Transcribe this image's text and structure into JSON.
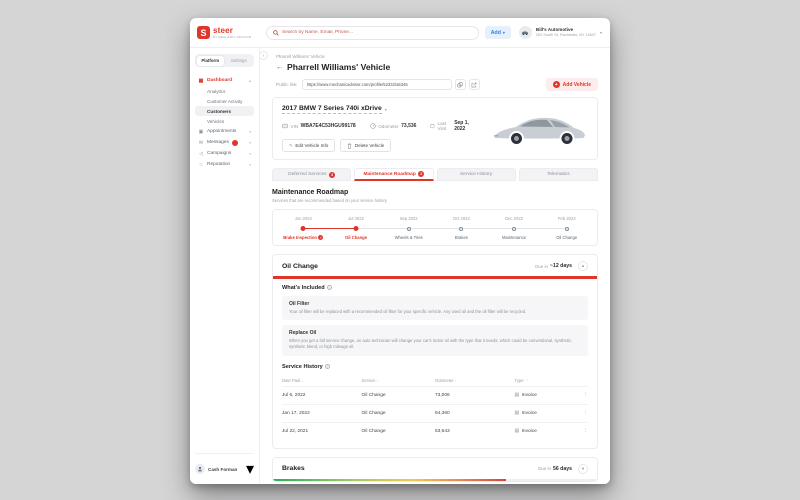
{
  "colors": {
    "accent_red": "#e0352b",
    "accent_blue": "#2f80ed",
    "progress_green": "#27ae60",
    "progress_yellow": "#f2c94c",
    "progress_red": "#eb5757"
  },
  "topbar": {
    "logo_text": "steer",
    "logo_tagline": "by mechanic advisor",
    "search_placeholder": "Search by Name, Email, Phone...",
    "add_button": "Add",
    "company_name": "Bill's Automotive",
    "company_address": "202 South St, Rochester, NY 14607"
  },
  "sidebar": {
    "mode_platform": "Platform",
    "mode_settings": "Settings",
    "dashboard": "Dashboard",
    "analytics": "Analytics",
    "customer_activity": "Customer Activity",
    "customers": "Customers",
    "vehicles": "Vehicles",
    "appointments": "Appointments",
    "messages": "Messages",
    "campaigns": "Campaigns",
    "reputation": "Reputation",
    "user_name": "Cash Forman"
  },
  "page": {
    "breadcrumb": "Pharrell Williams' Vehicle",
    "title": "Pharrell Williams' Vehicle",
    "public_link_label": "Public link",
    "public_link_value": "https://www.mechanicadvisor.com/profile/52332/a5345",
    "add_vehicle_button": "Add Vehicle"
  },
  "vehicle": {
    "name": "2017 BMW 7 Series 740i xDrive",
    "vin_label": "VIN",
    "vin": "WBA7E4C53HGU99178",
    "odometer_label": "Odometer",
    "odometer": "73,536",
    "last_visit_label": "Last Visit",
    "last_visit": "Sep 1, 2022",
    "edit_button": "Edit Vehicle Info",
    "delete_button": "Delete Vehicle"
  },
  "tabs": [
    {
      "label": "Deferred Services",
      "badge": "3"
    },
    {
      "label": "Maintenance Roadmap",
      "badge": "2"
    },
    {
      "label": "Service History",
      "badge": ""
    },
    {
      "label": "Telematics",
      "badge": ""
    }
  ],
  "roadmap": {
    "heading": "Maintenance Roadmap",
    "subheading": "Services that are recommended based on your service history",
    "milestones": [
      {
        "date": "Jun 2022",
        "label": "Brake Inspection"
      },
      {
        "date": "Jul 2022",
        "label": "Oil Change"
      },
      {
        "date": "Sep 2022",
        "label": "Wheels & Tires"
      },
      {
        "date": "Oct 2022",
        "label": "Brakes"
      },
      {
        "date": "Dec 2022",
        "label": "Maintenance"
      },
      {
        "date": "Feb 2023",
        "label": "Oil Change"
      }
    ]
  },
  "oil_card": {
    "title": "Oil Change",
    "due_prefix": "Due in",
    "due_value": "~12 days",
    "progress_percent": 100,
    "whats_included": "What's Included",
    "items": [
      {
        "name": "Oil Filter",
        "description": "Your oil filter will be replaced with a recommended oil filter for your specific vehicle. Any used oil and the oil filter will be recycled."
      },
      {
        "name": "Replace Oil",
        "description": "When you get a full service change, an auto technician will change your car's motor oil with the type that it needs, which could be conventional, synthetic, synthetic blend, or high mileage oil."
      }
    ],
    "service_history": "Service History",
    "columns": {
      "date": "Date Paid",
      "service": "Service",
      "odometer": "Odometer",
      "type": "Type"
    },
    "rows": [
      {
        "date": "Jul 6, 2022",
        "service": "Oil Change",
        "odometer": "73,006",
        "type": "Invoice"
      },
      {
        "date": "Jan 17, 2022",
        "service": "Oil Change",
        "odometer": "64,360",
        "type": "Invoice"
      },
      {
        "date": "Jul 22, 2021",
        "service": "Oil Change",
        "odometer": "53,643",
        "type": "Invoice"
      }
    ]
  },
  "brakes_card": {
    "title": "Brakes",
    "due_prefix": "Due in",
    "due_value": "56 days",
    "progress_percent": 72
  }
}
